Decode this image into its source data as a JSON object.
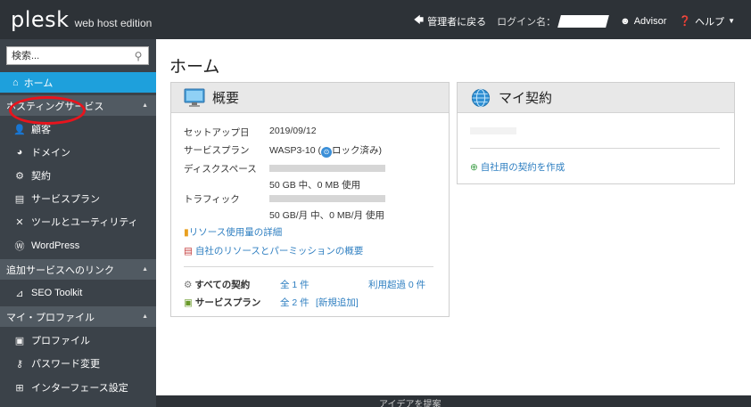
{
  "header": {
    "logo_main": "plesk",
    "logo_sub": "web host edition",
    "back_admin": "管理者に戻る",
    "login_label": "ログイン名：",
    "advisor": "Advisor",
    "help": "ヘルプ"
  },
  "sidebar": {
    "search_placeholder": "検索...",
    "home": "ホーム",
    "sections": [
      {
        "label": "ホスティングサービス",
        "items": [
          "顧客",
          "ドメイン",
          "契約",
          "サービスプラン",
          "ツールとユーティリティ",
          "WordPress"
        ]
      },
      {
        "label": "追加サービスへのリンク",
        "items": [
          "SEO Toolkit"
        ]
      },
      {
        "label": "マイ・プロファイル",
        "items": [
          "プロファイル",
          "パスワード変更",
          "インターフェース設定"
        ]
      }
    ]
  },
  "main": {
    "title": "ホーム",
    "overview": {
      "title": "概要",
      "setup_date_label": "セットアップ日",
      "setup_date": "2019/09/12",
      "plan_label": "サービスプラン",
      "plan_value": "WASP3-10 (",
      "plan_lock": "ロック済み)",
      "disk_label": "ディスクスペース",
      "disk_usage": "50 GB 中、0 MB 使用",
      "disk_used_fraction": 0,
      "traffic_label": "トラフィック",
      "traffic_usage": "50 GB/月 中、0 MB/月 使用",
      "traffic_used_fraction": 0,
      "resource_link": "リソース使用量の詳細",
      "permission_link": "自社のリソースとパーミッションの概要",
      "subs_label": "すべての契約",
      "subs_count": "全 1 件",
      "subs_over": "利用超過 0 件",
      "plans_label": "サービスプラン",
      "plans_count": "全 2 件",
      "plans_add": "[新規追加]"
    },
    "my_subscription": {
      "title": "マイ契約",
      "create_link": "自社用の契約を作成"
    }
  },
  "footer": {
    "text": "アイデアを提案"
  },
  "colors": {
    "topbar": "#2d3237",
    "sidebar": "#3b4249",
    "sidebar_section": "#515a62",
    "active": "#1ea0dc",
    "link": "#2f7fc1",
    "highlight": "#e8141d"
  }
}
